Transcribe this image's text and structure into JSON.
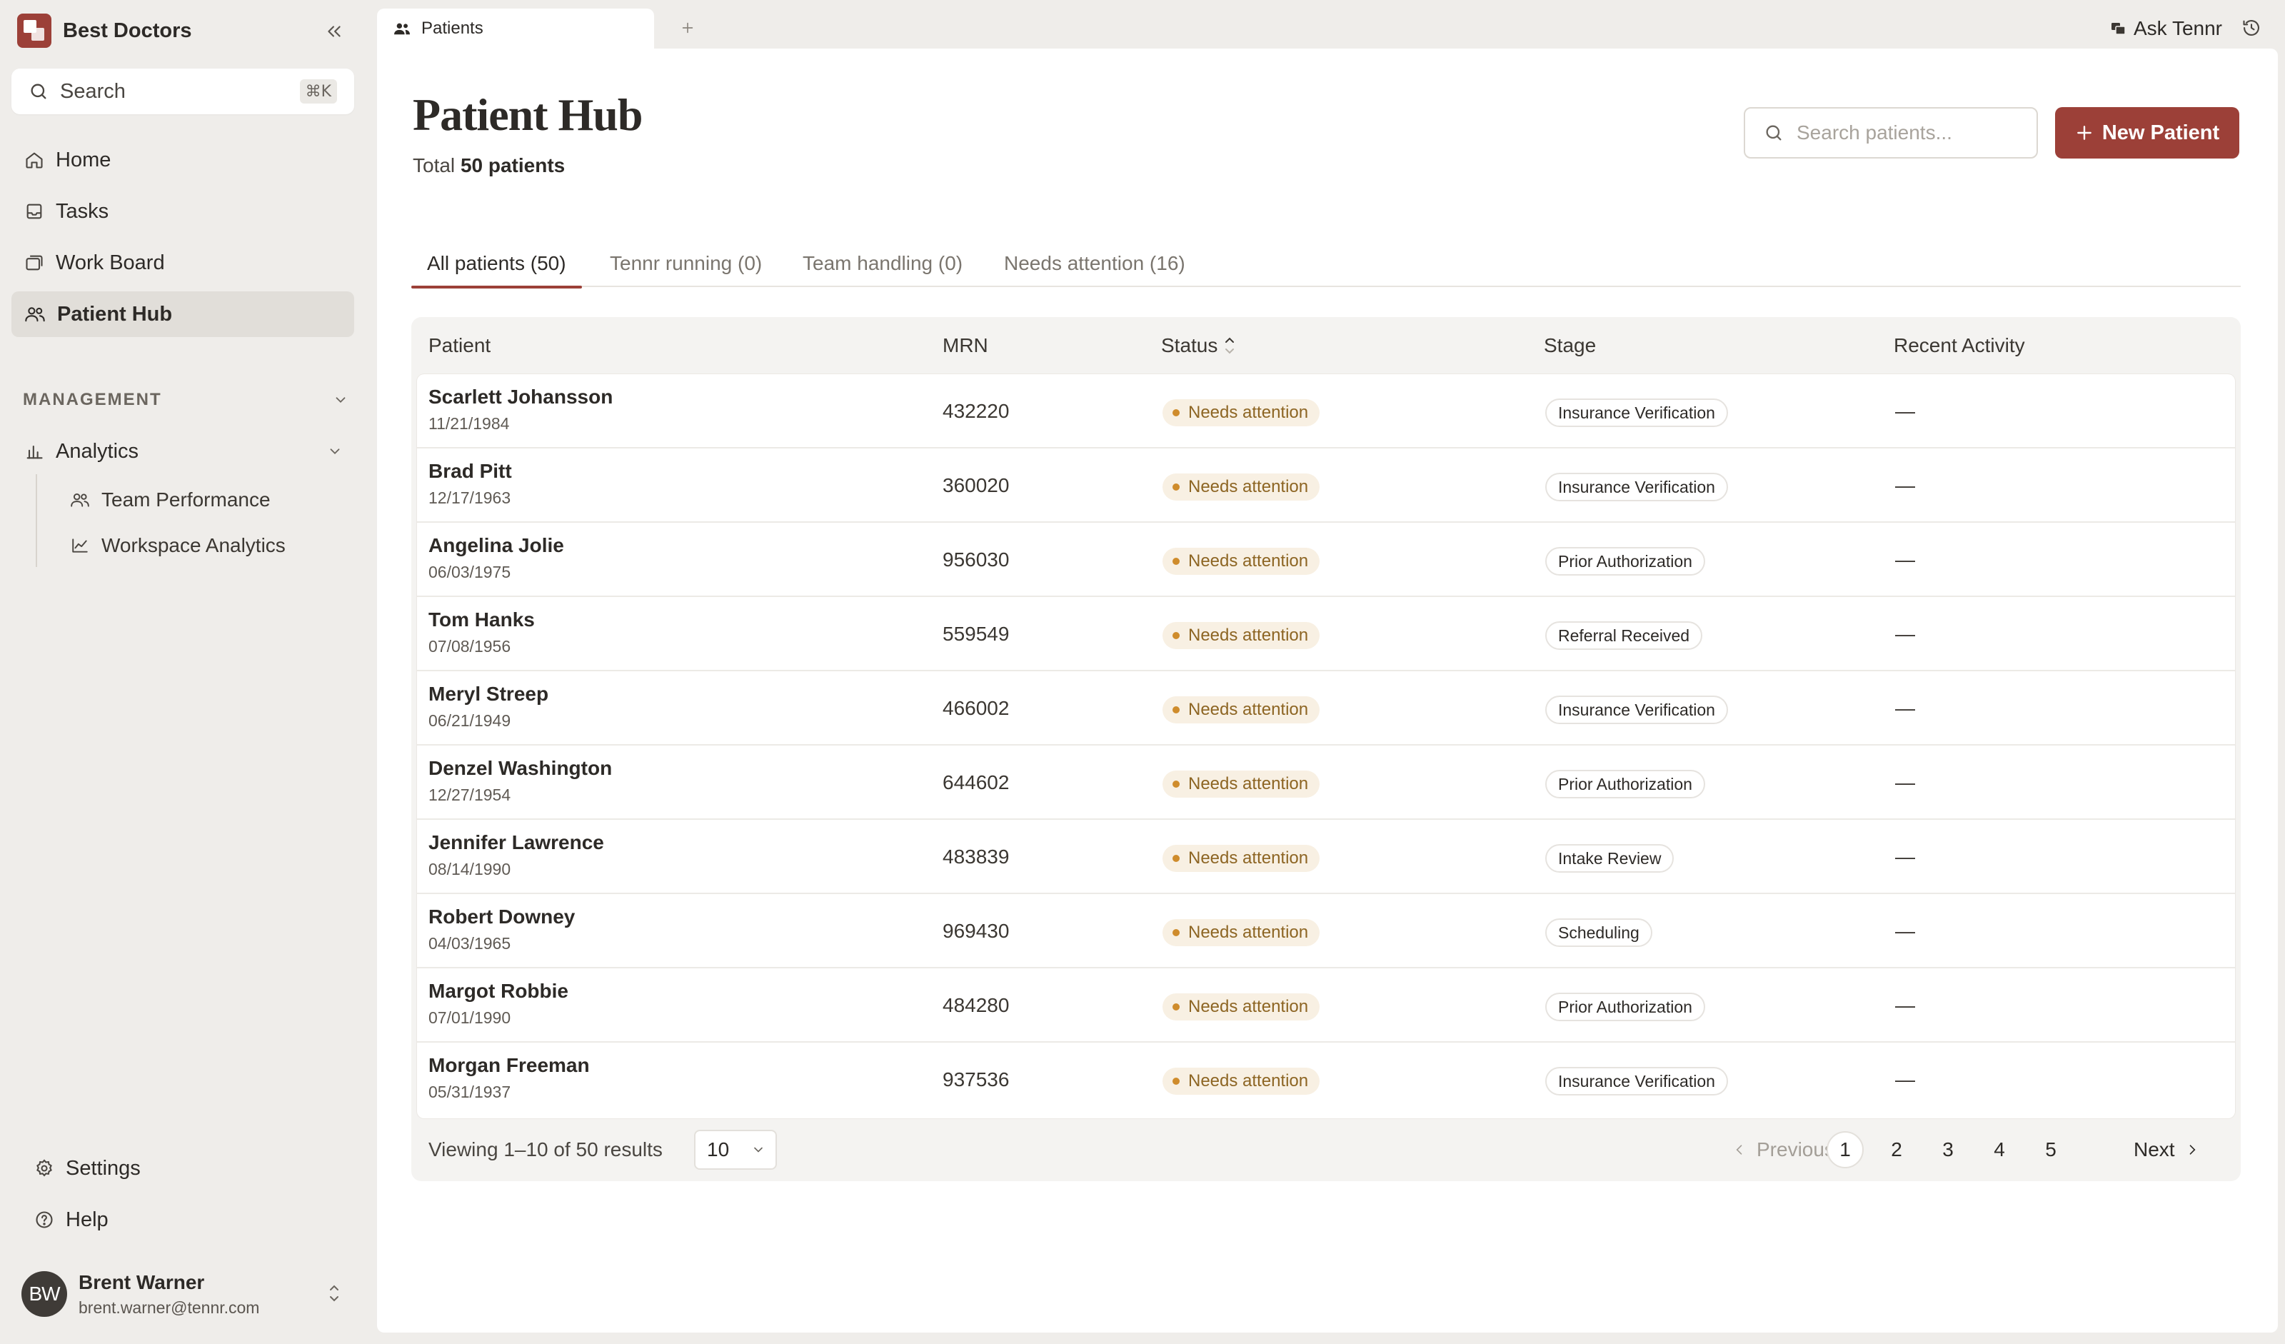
{
  "sidebar": {
    "org_name": "Best Doctors",
    "search": {
      "label": "Search",
      "shortcut": "⌘K"
    },
    "nav": [
      {
        "label": "Home",
        "icon": "home-icon"
      },
      {
        "label": "Tasks",
        "icon": "inbox-icon"
      },
      {
        "label": "Work Board",
        "icon": "board-icon"
      },
      {
        "label": "Patient Hub",
        "icon": "users-icon",
        "active": true
      }
    ],
    "section_label": "MANAGEMENT",
    "analytics": {
      "label": "Analytics",
      "children": [
        {
          "label": "Team Performance",
          "icon": "team-icon"
        },
        {
          "label": "Workspace Analytics",
          "icon": "line-chart-icon"
        }
      ]
    },
    "footer": [
      {
        "label": "Settings",
        "icon": "gear-icon"
      },
      {
        "label": "Help",
        "icon": "help-icon"
      }
    ],
    "user": {
      "initials": "BW",
      "name": "Brent Warner",
      "email": "brent.warner@tennr.com"
    }
  },
  "tabs": {
    "active_tab": "Patients",
    "ask_label": "Ask Tennr"
  },
  "main": {
    "title": "Patient Hub",
    "total_prefix": "Total",
    "total_count": "50 patients",
    "search_placeholder": "Search patients...",
    "new_button": "New Patient",
    "filters": [
      {
        "label": "All patients (50)",
        "active": true
      },
      {
        "label": "Tennr running (0)"
      },
      {
        "label": "Team handling (0)"
      },
      {
        "label": "Needs attention (16)"
      }
    ],
    "columns": {
      "patient": "Patient",
      "mrn": "MRN",
      "status": "Status",
      "stage": "Stage",
      "activity": "Recent Activity"
    },
    "rows": [
      {
        "name": "Scarlett Johansson",
        "dob": "11/21/1984",
        "mrn": "432220",
        "status": "Needs attention",
        "stage": "Insurance Verification",
        "activity": "—"
      },
      {
        "name": "Brad Pitt",
        "dob": "12/17/1963",
        "mrn": "360020",
        "status": "Needs attention",
        "stage": "Insurance Verification",
        "activity": "—"
      },
      {
        "name": "Angelina Jolie",
        "dob": "06/03/1975",
        "mrn": "956030",
        "status": "Needs attention",
        "stage": "Prior Authorization",
        "activity": "—"
      },
      {
        "name": "Tom Hanks",
        "dob": "07/08/1956",
        "mrn": "559549",
        "status": "Needs attention",
        "stage": "Referral Received",
        "activity": "—"
      },
      {
        "name": "Meryl Streep",
        "dob": "06/21/1949",
        "mrn": "466002",
        "status": "Needs attention",
        "stage": "Insurance Verification",
        "activity": "—"
      },
      {
        "name": "Denzel Washington",
        "dob": "12/27/1954",
        "mrn": "644602",
        "status": "Needs attention",
        "stage": "Prior Authorization",
        "activity": "—"
      },
      {
        "name": "Jennifer Lawrence",
        "dob": "08/14/1990",
        "mrn": "483839",
        "status": "Needs attention",
        "stage": "Intake Review",
        "activity": "—"
      },
      {
        "name": "Robert Downey",
        "dob": "04/03/1965",
        "mrn": "969430",
        "status": "Needs attention",
        "stage": "Scheduling",
        "activity": "—"
      },
      {
        "name": "Margot Robbie",
        "dob": "07/01/1990",
        "mrn": "484280",
        "status": "Needs attention",
        "stage": "Prior Authorization",
        "activity": "—"
      },
      {
        "name": "Morgan Freeman",
        "dob": "05/31/1937",
        "mrn": "937536",
        "status": "Needs attention",
        "stage": "Insurance Verification",
        "activity": "—"
      }
    ],
    "footer": {
      "viewing": "Viewing 1–10 of 50 results",
      "page_size": "10",
      "prev": "Previous",
      "next": "Next",
      "pages": [
        "1",
        "2",
        "3",
        "4",
        "5"
      ],
      "current_page": "1"
    }
  },
  "colors": {
    "accent": "#9c4038",
    "status_bg": "#f8f0e3",
    "status_text": "#8d6523",
    "status_dot": "#cf8c2c"
  }
}
